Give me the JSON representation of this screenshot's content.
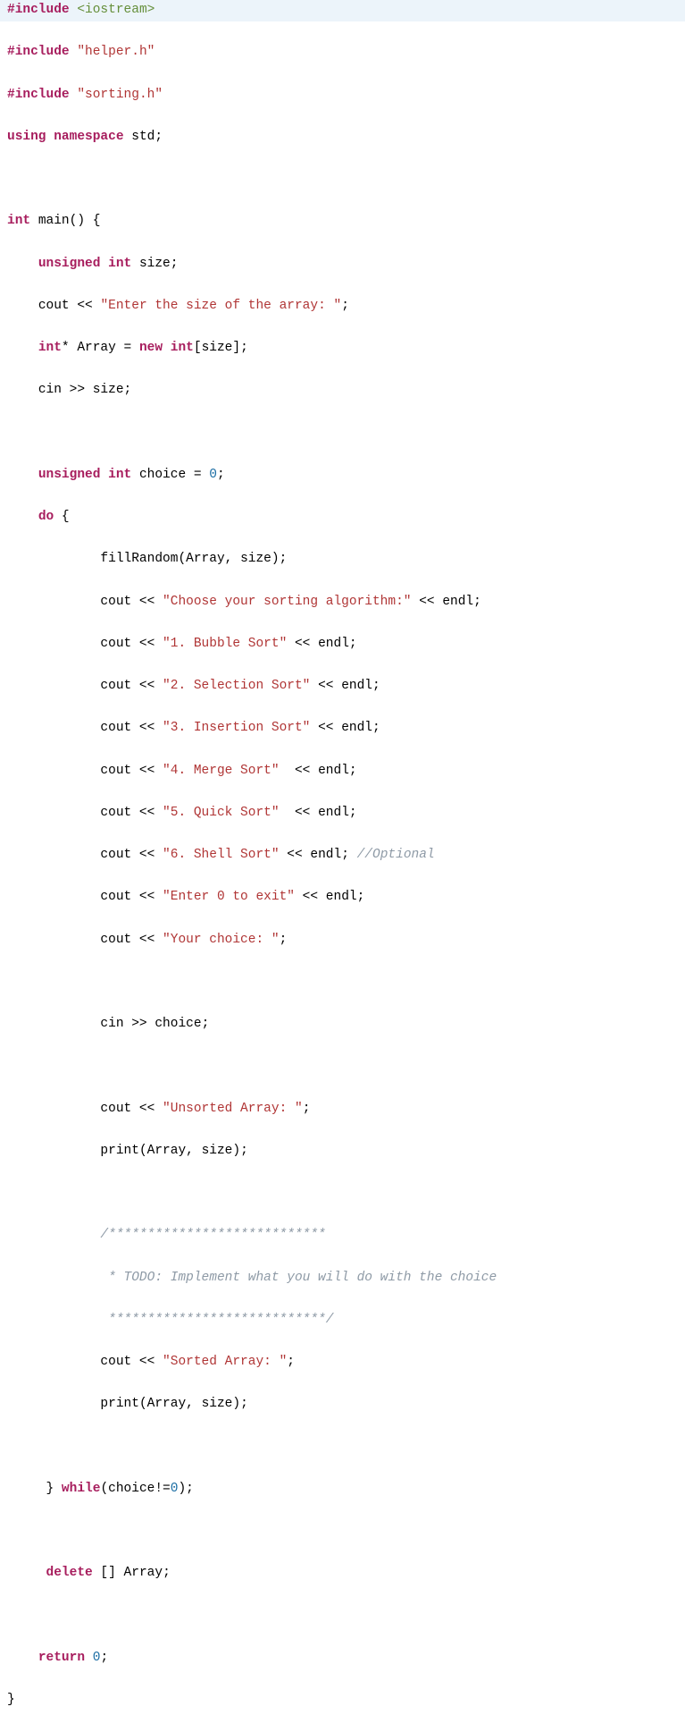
{
  "tokens": {
    "include": "#include",
    "iostream": "<iostream>",
    "helper": "\"helper.h\"",
    "sorting": "\"sorting.h\"",
    "using": "using",
    "namespace": "namespace",
    "std": "std",
    "int": "int",
    "main": "main",
    "unsigned": "unsigned",
    "size": "size",
    "cout": "cout",
    "cin": "cin",
    "endl": "endl",
    "Array": "Array",
    "new": "new",
    "choice": "choice",
    "zero": "0",
    "do": "do",
    "while": "while",
    "delete": "delete",
    "return": "return",
    "fillRandom": "fillRandom",
    "print": "print"
  },
  "strings": {
    "enterSize": "\"Enter the size of the array: \"",
    "chooseAlg": "\"Choose your sorting algorithm:\"",
    "bubble": "\"1. Bubble Sort\"",
    "selection": "\"2. Selection Sort\"",
    "insertion": "\"3. Insertion Sort\"",
    "merge": "\"4. Merge Sort\"",
    "quick": "\"5. Quick Sort\"",
    "shell": "\"6. Shell Sort\"",
    "exit": "\"Enter 0 to exit\"",
    "yourChoice": "\"Your choice: \"",
    "unsorted": "\"Unsorted Array: \"",
    "sorted": "\"Sorted Array: \""
  },
  "comments": {
    "optional": "//Optional",
    "block1": "/****************************",
    "todo": " * TODO: Implement what you will do with the choice",
    "block2": " ****************************/"
  }
}
